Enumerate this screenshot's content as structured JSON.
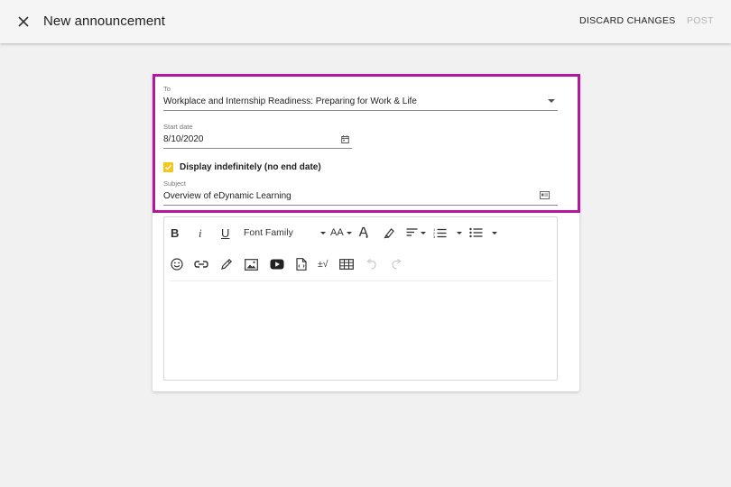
{
  "header": {
    "title": "New announcement",
    "discard_label": "DISCARD CHANGES",
    "post_label": "POST"
  },
  "form": {
    "to": {
      "label": "To",
      "value": "Workplace and Internship Readiness: Preparing for Work & Life"
    },
    "start_date": {
      "label": "Start date",
      "value": "8/10/2020"
    },
    "display_indefinitely": {
      "label": "Display indefinitely (no end date)",
      "checked": true
    },
    "subject": {
      "label": "Subject",
      "value": "Overview of eDynamic Learning"
    }
  },
  "editor": {
    "toolbar": {
      "bold_label": "B",
      "italic_label": "i",
      "underline_label": "U",
      "font_family_label": "Font Family",
      "font_size_label": "AA",
      "special_char_label": "±√"
    },
    "icons": [
      "bold",
      "italic",
      "underline",
      "font-size",
      "text-color",
      "highlight",
      "align",
      "ordered-list",
      "unordered-list",
      "emoji",
      "link",
      "draw",
      "image",
      "video",
      "file",
      "special-character",
      "table",
      "undo",
      "redo"
    ]
  },
  "colors": {
    "highlight_border": "#b5179e",
    "checkbox": "#f5c518",
    "disabled_text": "#b3b3b3"
  }
}
